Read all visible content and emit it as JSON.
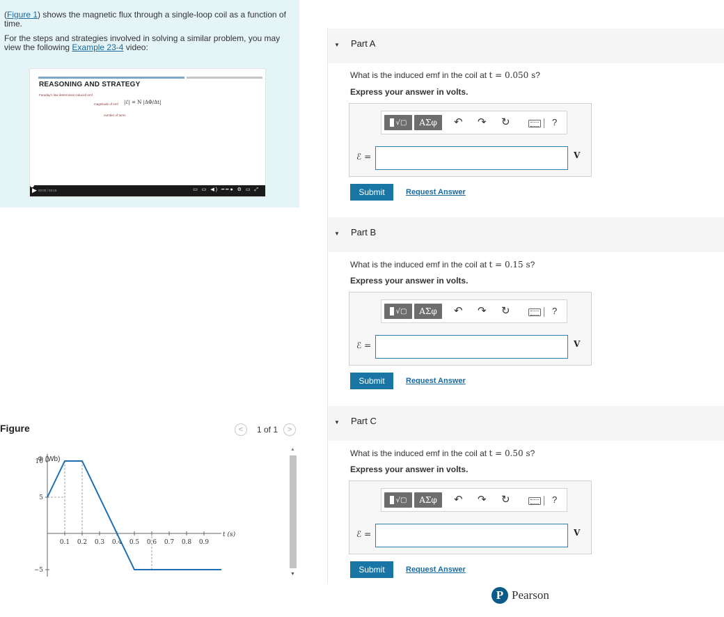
{
  "intro": {
    "figure_link": "Figure 1",
    "line1_rest": ") shows the magnetic flux through a single-loop coil as a function of time.",
    "line2_start": "For the steps and strategies involved in solving a similar problem, you may view the following ",
    "example_link": "Example 23-4",
    "line2_end": " video:"
  },
  "video": {
    "title": "REASONING AND STRATEGY",
    "subtitle": "Faraday's law determines induced emf",
    "eq_label1": "magnitude of emf",
    "eq_label2": "number of turns",
    "formula": "|ℰ| = N |ΔΦ/Δt|",
    "time": "00:00 / 03:16",
    "play_icon": "play-icon"
  },
  "figure": {
    "label": "Figure",
    "pager_text": "1 of 1",
    "prev": "<",
    "next": ">"
  },
  "chart_data": {
    "type": "line",
    "ylabel": "Φ (Wb)",
    "xlabel": "t (s)",
    "x": [
      0,
      0.1,
      0.2,
      0.5,
      0.6,
      1.0
    ],
    "y": [
      5,
      10,
      10,
      -5,
      -5,
      -5
    ],
    "xticks": [
      "0.1",
      "0.2",
      "0.3",
      "0.4",
      "0.5",
      "0.6",
      "0.7",
      "0.8",
      "0.9"
    ],
    "yticks": [
      "10",
      "5",
      "−5"
    ],
    "xlim": [
      0,
      1.0
    ],
    "ylim": [
      -6,
      11
    ],
    "grid": false
  },
  "parts": [
    {
      "title": "Part A",
      "question_pre": "What is the induced emf in the coil at ",
      "question_math": "t = 0.050 s",
      "question_post": "?",
      "instruction": "Express your answer in volts.",
      "eps_label": "ℰ =",
      "answer_value": "",
      "unit": "V",
      "submit": "Submit",
      "request": "Request Answer"
    },
    {
      "title": "Part B",
      "question_pre": "What is the induced emf in the coil at ",
      "question_math": "t = 0.15 s",
      "question_post": "?",
      "instruction": "Express your answer in volts.",
      "eps_label": "ℰ =",
      "answer_value": "",
      "unit": "V",
      "submit": "Submit",
      "request": "Request Answer"
    },
    {
      "title": "Part C",
      "question_pre": "What is the induced emf in the coil at ",
      "question_math": "t = 0.50 s",
      "question_post": "?",
      "instruction": "Express your answer in volts.",
      "eps_label": "ℰ =",
      "answer_value": "",
      "unit": "V",
      "submit": "Submit",
      "request": "Request Answer"
    }
  ],
  "toolbar": {
    "templates": "√▢",
    "greek": "ΑΣφ",
    "undo_icon": "undo-icon",
    "redo_icon": "redo-icon",
    "reset_icon": "reset-icon",
    "keyboard_icon": "keyboard-icon",
    "help": "?"
  },
  "footer": {
    "brand": "Pearson",
    "logo_letter": "P"
  },
  "colors": {
    "intro_bg": "#e4f4f7",
    "link": "#1a6aa0",
    "submit_bg": "#1875a4",
    "plot_line": "#1f6fb0"
  }
}
